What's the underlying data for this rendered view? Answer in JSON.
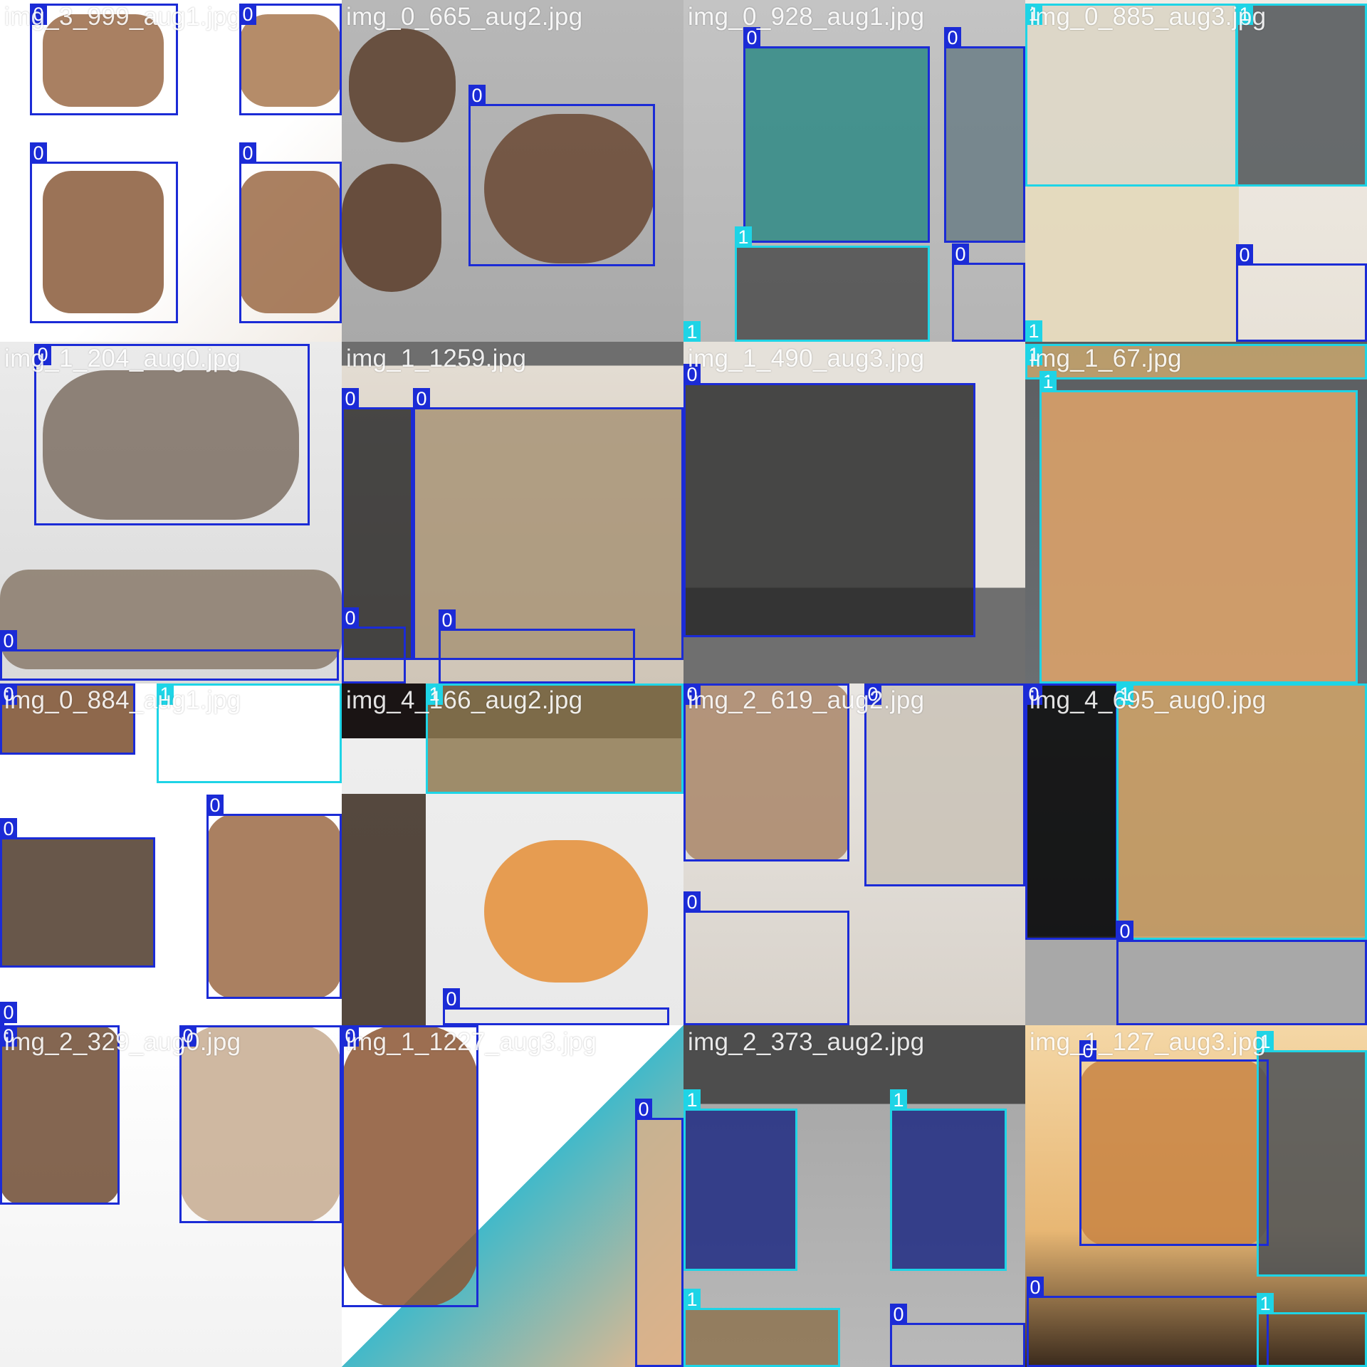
{
  "mosaic": {
    "class_colors": {
      "0": "#1b2bd6",
      "1": "#1ed4e6"
    },
    "tiles": [
      {
        "name": "tile-r0c0",
        "title": "img_3_999_aug1.jpg",
        "bg": "linear-gradient(135deg,#ffffff 0%,#ffffff 60%,#f1ebe4 100%)",
        "patches": [
          {
            "fill": "#9a6a47"
          },
          {
            "fill": "#a8784f"
          },
          {
            "fill": "#8a5a3a"
          },
          {
            "fill": "#9b6a45"
          }
        ],
        "boxes": [
          {
            "cls": "0"
          },
          {
            "cls": "0"
          },
          {
            "cls": "0"
          },
          {
            "cls": "0"
          }
        ]
      },
      {
        "name": "tile-r0c1",
        "title": "img_0_665_aug2.jpg",
        "bg": "linear-gradient(180deg,#b8b8b8 0%,#a9a9a9 100%)",
        "patches": [
          {
            "fill": "#5b3e2b"
          },
          {
            "fill": "#6a4833"
          },
          {
            "fill": "#5a3c29"
          }
        ],
        "boxes": [
          {
            "cls": "0"
          }
        ]
      },
      {
        "name": "tile-r0c2",
        "title": "img_0_928_aug1.jpg",
        "bg": "linear-gradient(180deg,#c4c4c4 0%,#b5b5b5 100%)",
        "patches": [
          {
            "fill": "#2f8a85"
          },
          {
            "fill": "#6b7e86"
          },
          {
            "fill": "#4c4c4c"
          }
        ],
        "boxes": [
          {
            "cls": "0"
          },
          {
            "cls": "0"
          },
          {
            "cls": "1"
          },
          {
            "cls": "0"
          },
          {
            "cls": "1"
          }
        ]
      },
      {
        "name": "tile-r0c3",
        "title": "img_0_885_aug3.jpg",
        "bg": "linear-gradient(180deg,#f0ece6 0%,#e8e2d8 100%)",
        "patches": [
          {
            "fill": "#d9d3c3"
          },
          {
            "fill": "#4f5457"
          },
          {
            "fill": "#e3d7b8"
          }
        ],
        "boxes": [
          {
            "cls": "1"
          },
          {
            "cls": "1"
          },
          {
            "cls": "0"
          },
          {
            "cls": "1"
          }
        ]
      },
      {
        "name": "tile-r1c0",
        "title": "img_1_204_aug0.jpg",
        "bg": "linear-gradient(180deg,#ebebeb 0%,#dadada 100%)",
        "patches": [
          {
            "fill": "#7d6f63"
          },
          {
            "fill": "#8a7a6b"
          }
        ],
        "boxes": [
          {
            "cls": "0"
          },
          {
            "cls": "0"
          }
        ]
      },
      {
        "name": "tile-r1c1",
        "title": "img_1_1259.jpg",
        "bg": "linear-gradient(180deg,#6e6e6e 0%,#6e6e6e 7%,#e3dcd2 7%,#cfc5b7 100%)",
        "patches": [
          {
            "fill": "#2b2b2b"
          },
          {
            "fill": "#a89477"
          }
        ],
        "boxes": [
          {
            "cls": "0"
          },
          {
            "cls": "0"
          },
          {
            "cls": "0"
          },
          {
            "cls": "0"
          }
        ]
      },
      {
        "name": "tile-r1c2",
        "title": "img_1_490_aug3.jpg",
        "bg": "linear-gradient(180deg,#e5e1da 0%,#e5e1da 72%,#6f6f6f 72%,#6f6f6f 100%)",
        "patches": [
          {
            "fill": "#2a2a2a"
          }
        ],
        "boxes": [
          {
            "cls": "0"
          }
        ]
      },
      {
        "name": "tile-r1c3",
        "title": "img_1_67.jpg",
        "bg": "linear-gradient(180deg,#5b5e61 0%,#6b6e71 100%)",
        "patches": [
          {
            "fill": "#e0a46a"
          },
          {
            "fill": "#c9a76e"
          }
        ],
        "boxes": [
          {
            "cls": "1"
          },
          {
            "cls": "1"
          }
        ]
      },
      {
        "name": "tile-r2c0",
        "title": "img_0_884_aug1.jpg",
        "bg": "linear-gradient(180deg,#ffffff 0%,#ffffff 100%)",
        "patches": [
          {
            "fill": "#7a4d2d"
          },
          {
            "fill": "#4e3a2a"
          },
          {
            "fill": "#9b6a45"
          }
        ],
        "boxes": [
          {
            "cls": "0"
          },
          {
            "cls": "1"
          },
          {
            "cls": "0"
          },
          {
            "cls": "0"
          },
          {
            "cls": "0"
          }
        ]
      },
      {
        "name": "tile-r2c1",
        "title": "img_4_166_aug2.jpg",
        "bg": "linear-gradient(180deg,#1a1414 0%,#1a1414 16%,#eeeeee 16%,#e9e9e9 100%)",
        "patches": [
          {
            "fill": "#8f7a52"
          },
          {
            "fill": "#3a2a1f"
          },
          {
            "fill": "#e58e36"
          }
        ],
        "boxes": [
          {
            "cls": "1"
          },
          {
            "cls": "0"
          }
        ]
      },
      {
        "name": "tile-r2c2",
        "title": "img_2_619_aug2.jpg",
        "bg": "linear-gradient(180deg,#e9e6e2 0%,#d8d2ca 100%)",
        "patches": [
          {
            "fill": "#a98668"
          },
          {
            "fill": "#c9c2b6"
          }
        ],
        "boxes": [
          {
            "cls": "0"
          },
          {
            "cls": "0"
          },
          {
            "cls": "0"
          }
        ]
      },
      {
        "name": "tile-r2c3",
        "title": "img_4_695_aug0.jpg",
        "bg": "linear-gradient(180deg,#6a6e73 0%,#5b5f63 74%,#a8a8a8 74%,#a8a8a8 100%)",
        "patches": [
          {
            "fill": "#0b0b0b"
          },
          {
            "fill": "#d2a567"
          }
        ],
        "boxes": [
          {
            "cls": "0"
          },
          {
            "cls": "1"
          },
          {
            "cls": "0"
          }
        ]
      },
      {
        "name": "tile-r3c0",
        "title": "img_2_329_aug0.jpg",
        "bg": "linear-gradient(180deg,#ffffff 0%,#f2f2f2 100%)",
        "patches": [
          {
            "fill": "#6e4b33"
          },
          {
            "fill": "#c7ab90"
          }
        ],
        "boxes": [
          {
            "cls": "0"
          },
          {
            "cls": "0"
          }
        ]
      },
      {
        "name": "tile-r3c1",
        "title": "img_1_1227_aug3.jpg",
        "bg": "linear-gradient(135deg,#ffffff 0%,#ffffff 50%,#43b9c9 50%,#f0b88a 100%)",
        "patches": [
          {
            "fill": "#8b5532"
          },
          {
            "fill": "#d9b08a"
          }
        ],
        "boxes": [
          {
            "cls": "0"
          },
          {
            "cls": "0"
          }
        ]
      },
      {
        "name": "tile-r3c2",
        "title": "img_2_373_aug2.jpg",
        "bg": "linear-gradient(180deg,#4d4d4d 0%,#4d4d4d 23%,#a9a9a9 23%,#b9b9b9 100%)",
        "patches": [
          {
            "fill": "#1f2a82"
          },
          {
            "fill": "#1f2a82"
          },
          {
            "fill": "#8d7350"
          }
        ],
        "boxes": [
          {
            "cls": "1"
          },
          {
            "cls": "1"
          },
          {
            "cls": "1"
          },
          {
            "cls": "0"
          }
        ]
      },
      {
        "name": "tile-r3c3",
        "title": "img_1_127_aug3.jpg",
        "bg": "linear-gradient(180deg,#f4d7a6 0%,#e8b774 60%,#3a2a1c 100%)",
        "patches": [
          {
            "fill": "#c88443"
          },
          {
            "fill": "#4b5055"
          }
        ],
        "boxes": [
          {
            "cls": "0"
          },
          {
            "cls": "1"
          },
          {
            "cls": "0"
          },
          {
            "cls": "1"
          }
        ]
      }
    ]
  }
}
